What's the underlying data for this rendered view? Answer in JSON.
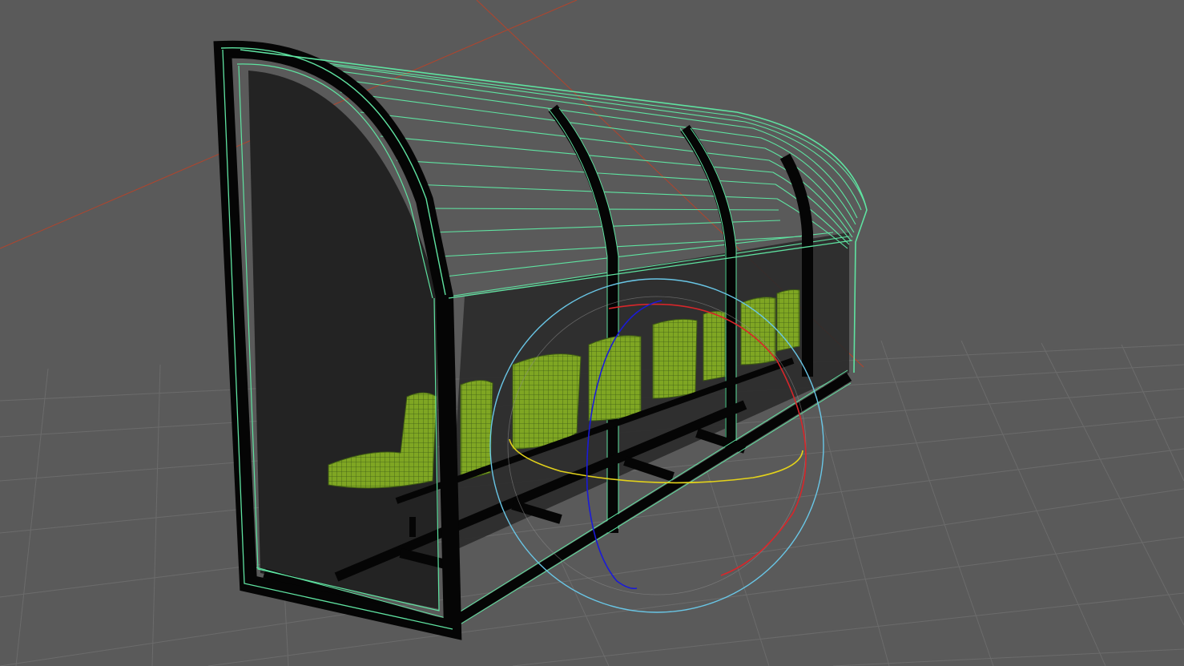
{
  "viewport": {
    "background_color": "#5a5a5a",
    "grid_color": "#6e6e6e",
    "world_axis_color": "#b2442c"
  },
  "model": {
    "wireframe_color": "#5fe3a1",
    "frame_color": "#050505",
    "glass_color": "#1f1f1f",
    "seat_color": "#7fa623",
    "seat_count": 8
  },
  "gizmo": {
    "type": "rotate",
    "outer_ring_color": "#69c6e6",
    "x_ring_color": "#d8262a",
    "y_ring_color": "#e3d21a",
    "z_ring_color": "#1a1ad8"
  }
}
